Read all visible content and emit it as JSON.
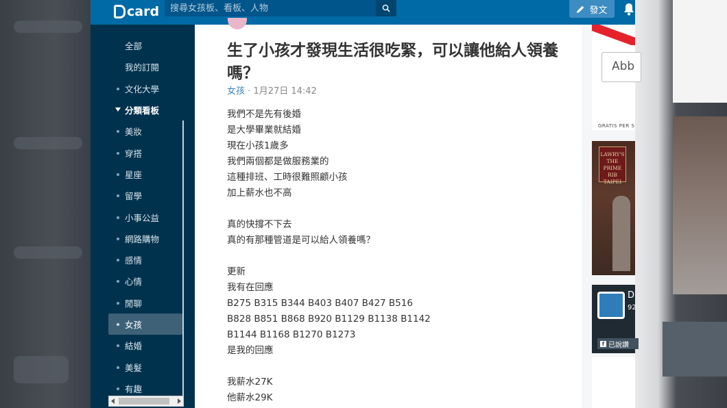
{
  "app": {
    "logo_text": "card"
  },
  "search": {
    "placeholder": "搜尋女孩板、看板、人物"
  },
  "header": {
    "post_label": "發文"
  },
  "sidebar": {
    "top_items": [
      {
        "label": "全部"
      },
      {
        "label": "我的訂閱"
      },
      {
        "label": "文化大學"
      }
    ],
    "section_label": "分類看板",
    "boards": [
      {
        "label": "美妝"
      },
      {
        "label": "穿搭"
      },
      {
        "label": "星座"
      },
      {
        "label": "留學"
      },
      {
        "label": "小事公益"
      },
      {
        "label": "網路購物"
      },
      {
        "label": "感情"
      },
      {
        "label": "心情"
      },
      {
        "label": "閒聊"
      },
      {
        "label": "女孩",
        "active": true
      },
      {
        "label": "結婚"
      },
      {
        "label": "美髮"
      },
      {
        "label": "有趣"
      }
    ]
  },
  "article": {
    "title": "生了小孩才發現生活很吃緊，可以讓他給人領養嗎？",
    "board": "女孩",
    "datetime": "1月27日 14:42",
    "lines": [
      "我們不是先有後婚",
      "是大學畢業就結婚",
      "現在小孩1歲多",
      "我們兩個都是做服務業的",
      "這種排班、工時很難照顧小孩",
      "加上薪水也不高",
      "",
      "真的快撐不下去",
      "真的有那種管道是可以給人領養嗎？",
      "",
      "更新",
      "我有在回應",
      "B275 B315 B344 B403 B407 B427 B516",
      "B828 B851 B868 B920 B1129 B1138 B1142",
      "B1144 B1168 B1270 B1273",
      "是我的回應",
      "",
      "我薪水27K",
      "他薪水29K"
    ]
  },
  "ads": {
    "ad1_text": "Abb",
    "ad1_footer": "GRATIS PER S",
    "ad2_text": "LAWRY'S THE PRIME RIB TAIPEI",
    "ad3_title": "D",
    "ad3_number": "92",
    "ad3_follow": "已說讚"
  },
  "colors": {
    "topbar": "#006aa6",
    "sidebar": "#00324e",
    "active_item": "#3e6178",
    "board_link": "#3b84b9"
  }
}
